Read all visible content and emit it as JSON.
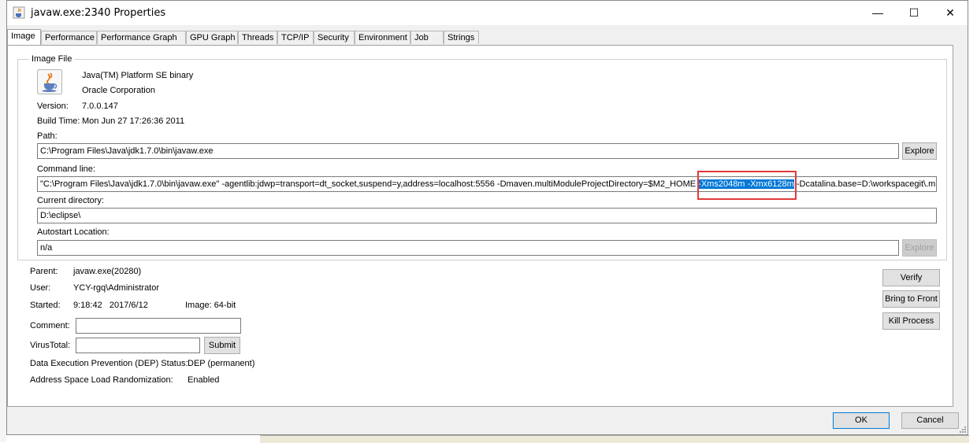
{
  "window": {
    "title": "javaw.exe:2340 Properties",
    "icon": "java-coffee-cup-icon",
    "controls": {
      "minimize": "—",
      "maximize": "☐",
      "close": "✕"
    }
  },
  "tabs": [
    "Image",
    "Performance",
    "Performance Graph",
    "GPU Graph",
    "Threads",
    "TCP/IP",
    "Security",
    "Environment",
    "Job",
    "Strings"
  ],
  "active_tab": "Image",
  "image_file": {
    "group_label": "Image File",
    "description": "Java(TM) Platform SE binary",
    "company": "Oracle Corporation",
    "version_label": "Version:",
    "version": "7.0.0.147",
    "build_time_label": "Build Time:",
    "build_time": "Mon Jun 27 17:26:36 2011",
    "path_label": "Path:",
    "path": "C:\\Program Files\\Java\\jdk1.7.0\\bin\\javaw.exe",
    "explore_label": "Explore",
    "command_line_label": "Command line:",
    "command_line_before": "\"C:\\Program Files\\Java\\jdk1.7.0\\bin\\javaw.exe\" -agentlib:jdwp=transport=dt_socket,suspend=y,address=localhost:5556 -Dmaven.multiModuleProjectDirectory=$M2_HOME",
    "command_line_selected": "-Xms2048m -Xmx6128m",
    "command_line_after": "-Dcatalina.base=D:\\workspacegit\\.m",
    "current_directory_label": "Current directory:",
    "current_directory": "D:\\eclipse\\",
    "autostart_label": "Autostart Location:",
    "autostart": "n/a",
    "autostart_explore_label": "Explore"
  },
  "process": {
    "parent_label": "Parent:",
    "parent": "javaw.exe(20280)",
    "user_label": "User:",
    "user": "YCY-rgq\\Administrator",
    "started_label": "Started:",
    "started": "9:18:42   2017/6/12",
    "image_label": "Image: 64-bit",
    "comment_label": "Comment:",
    "comment": "",
    "virustotal_label": "VirusTotal:",
    "virustotal": "",
    "submit_label": "Submit",
    "dep_label": "Data Execution Prevention (DEP) Status:",
    "dep": "DEP (permanent)",
    "aslr_label": "Address Space Load Randomization:",
    "aslr": "Enabled"
  },
  "side_buttons": {
    "verify": "Verify",
    "bring_to_front": "Bring to Front",
    "kill_process": "Kill Process"
  },
  "footer": {
    "ok": "OK",
    "cancel": "Cancel"
  },
  "colors": {
    "selection": "#0078d7",
    "annotation": "#e03a3a"
  }
}
